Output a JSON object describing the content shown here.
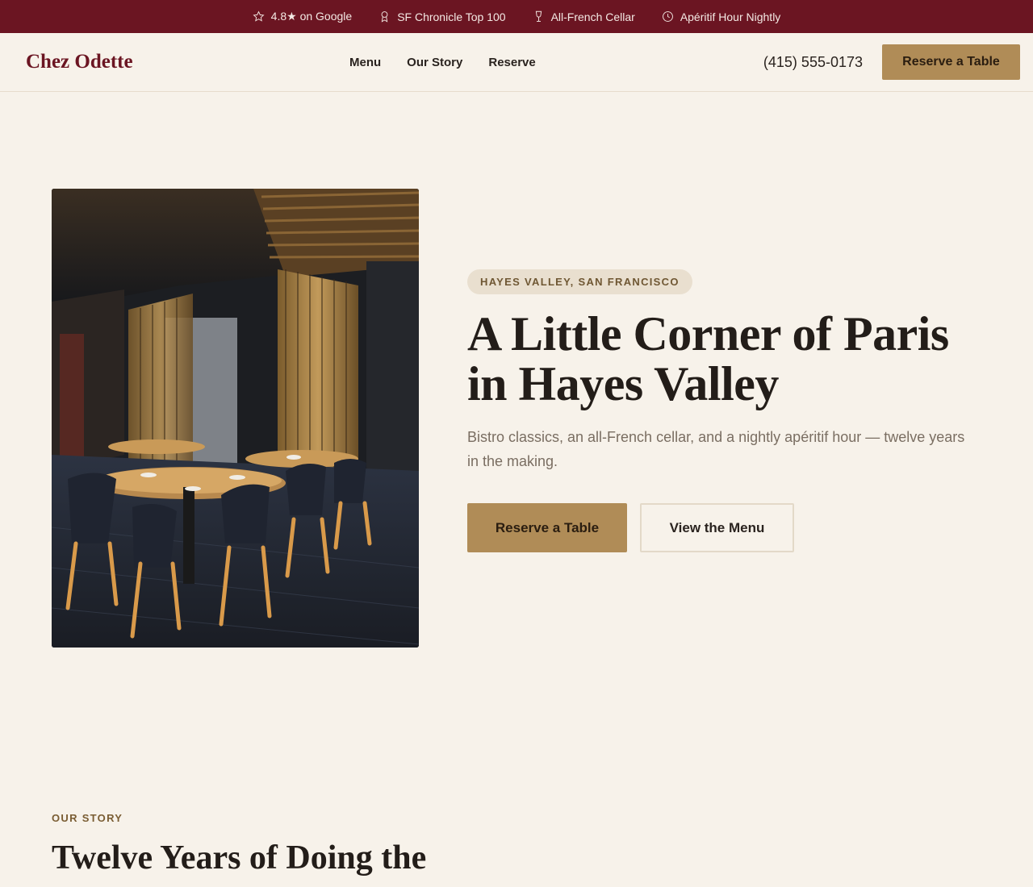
{
  "topbar": {
    "items": [
      {
        "icon": "star-icon",
        "label": "4.8★ on Google"
      },
      {
        "icon": "award-icon",
        "label": "SF Chronicle Top 100"
      },
      {
        "icon": "wine-glass-icon",
        "label": "All-French Cellar"
      },
      {
        "icon": "clock-icon",
        "label": "Apéritif Hour Nightly"
      }
    ]
  },
  "header": {
    "logo": "Chez Odette",
    "nav": [
      "Menu",
      "Our Story",
      "Reserve"
    ],
    "phone": "(415) 555-0173",
    "cta": "Reserve a Table"
  },
  "hero": {
    "eyebrow": "HAYES VALLEY, SAN FRANCISCO",
    "title": "A Little Corner of Paris in Hayes Valley",
    "subtitle": "Bistro classics, an all-French cellar, and a nightly apéritif hour — twelve years in the making.",
    "primary_button": "Reserve a Table",
    "secondary_button": "View the Menu"
  },
  "story": {
    "eyebrow": "OUR STORY",
    "title": "Twelve Years of Doing the"
  },
  "colors": {
    "brand": "#6b1522",
    "accent": "#b08c57",
    "background": "#f7f2ea"
  }
}
